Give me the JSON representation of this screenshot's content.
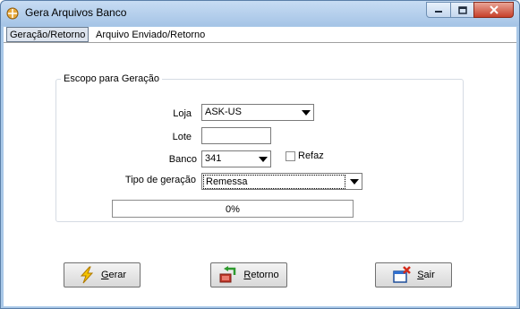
{
  "window": {
    "title": "Gera Arquivos Banco"
  },
  "tabs": [
    {
      "label": "Geração/Retorno",
      "active": true
    },
    {
      "label": "Arquivo Enviado/Retorno",
      "active": false
    }
  ],
  "group": {
    "title": "Escopo para Geração"
  },
  "form": {
    "loja_label": "Loja",
    "loja_value": "ASK-US",
    "lote_label": "Lote",
    "lote_value": "",
    "banco_label": "Banco",
    "banco_value": "341",
    "refaz_label": "Refaz",
    "refaz_checked": false,
    "tipo_label": "Tipo de geração",
    "tipo_value": "Remessa"
  },
  "progress": {
    "text": "0%",
    "value": 0
  },
  "buttons": {
    "gerar_u": "G",
    "gerar_rest": "erar",
    "retorno_u": "R",
    "retorno_rest": "etorno",
    "sair_u": "S",
    "sair_rest": "air"
  },
  "colors": {
    "titlebar": "#a9c8e8",
    "close": "#c7402a",
    "progress": "#3a8ed8"
  },
  "icons": [
    "app-icon",
    "minimize-icon",
    "maximize-icon",
    "close-icon",
    "lightning-icon",
    "return-icon",
    "exit-icon"
  ]
}
